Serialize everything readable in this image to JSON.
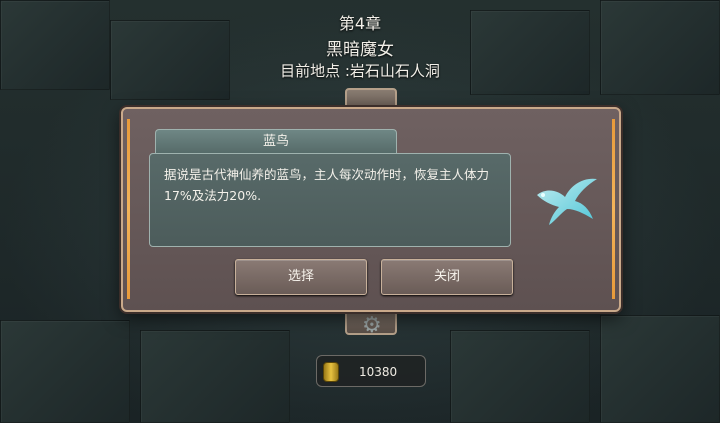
{
  "header": {
    "chapter": "第4章",
    "level_name": "黑暗魔女",
    "location": "目前地点 :岩石山石人洞"
  },
  "dialog": {
    "pet_name": "蓝鸟",
    "description": "据说是古代神仙养的蓝鸟，主人每次动作时，恢复主人体力17%及法力20%.",
    "pet_icon": "blue-bird",
    "select_label": "选择",
    "close_label": "关闭"
  },
  "currency": {
    "coin_icon": "gold-coin-stack-icon",
    "amount": "10380"
  }
}
